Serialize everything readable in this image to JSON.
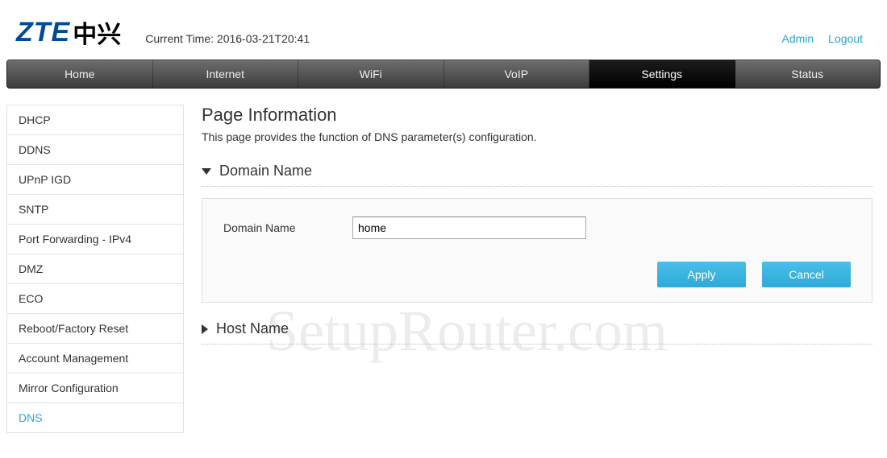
{
  "header": {
    "logo_zte": "ZTE",
    "logo_cn": "中兴",
    "current_time_label": "Current Time: 2016-03-21T20:41",
    "admin": "Admin",
    "logout": "Logout"
  },
  "topnav": [
    "Home",
    "Internet",
    "WiFi",
    "VoIP",
    "Settings",
    "Status"
  ],
  "topnav_active_index": 4,
  "sidebar": [
    "DHCP",
    "DDNS",
    "UPnP IGD",
    "SNTP",
    "Port Forwarding - IPv4",
    "DMZ",
    "ECO",
    "Reboot/Factory Reset",
    "Account Management",
    "Mirror Configuration",
    "DNS"
  ],
  "sidebar_active_index": 10,
  "main": {
    "title": "Page Information",
    "description": "This page provides the function of DNS parameter(s) configuration.",
    "section_domain": {
      "heading": "Domain Name",
      "field_label": "Domain Name",
      "field_value": "home",
      "apply": "Apply",
      "cancel": "Cancel"
    },
    "section_host": {
      "heading": "Host Name"
    }
  },
  "watermark": "SetupRouter.com"
}
